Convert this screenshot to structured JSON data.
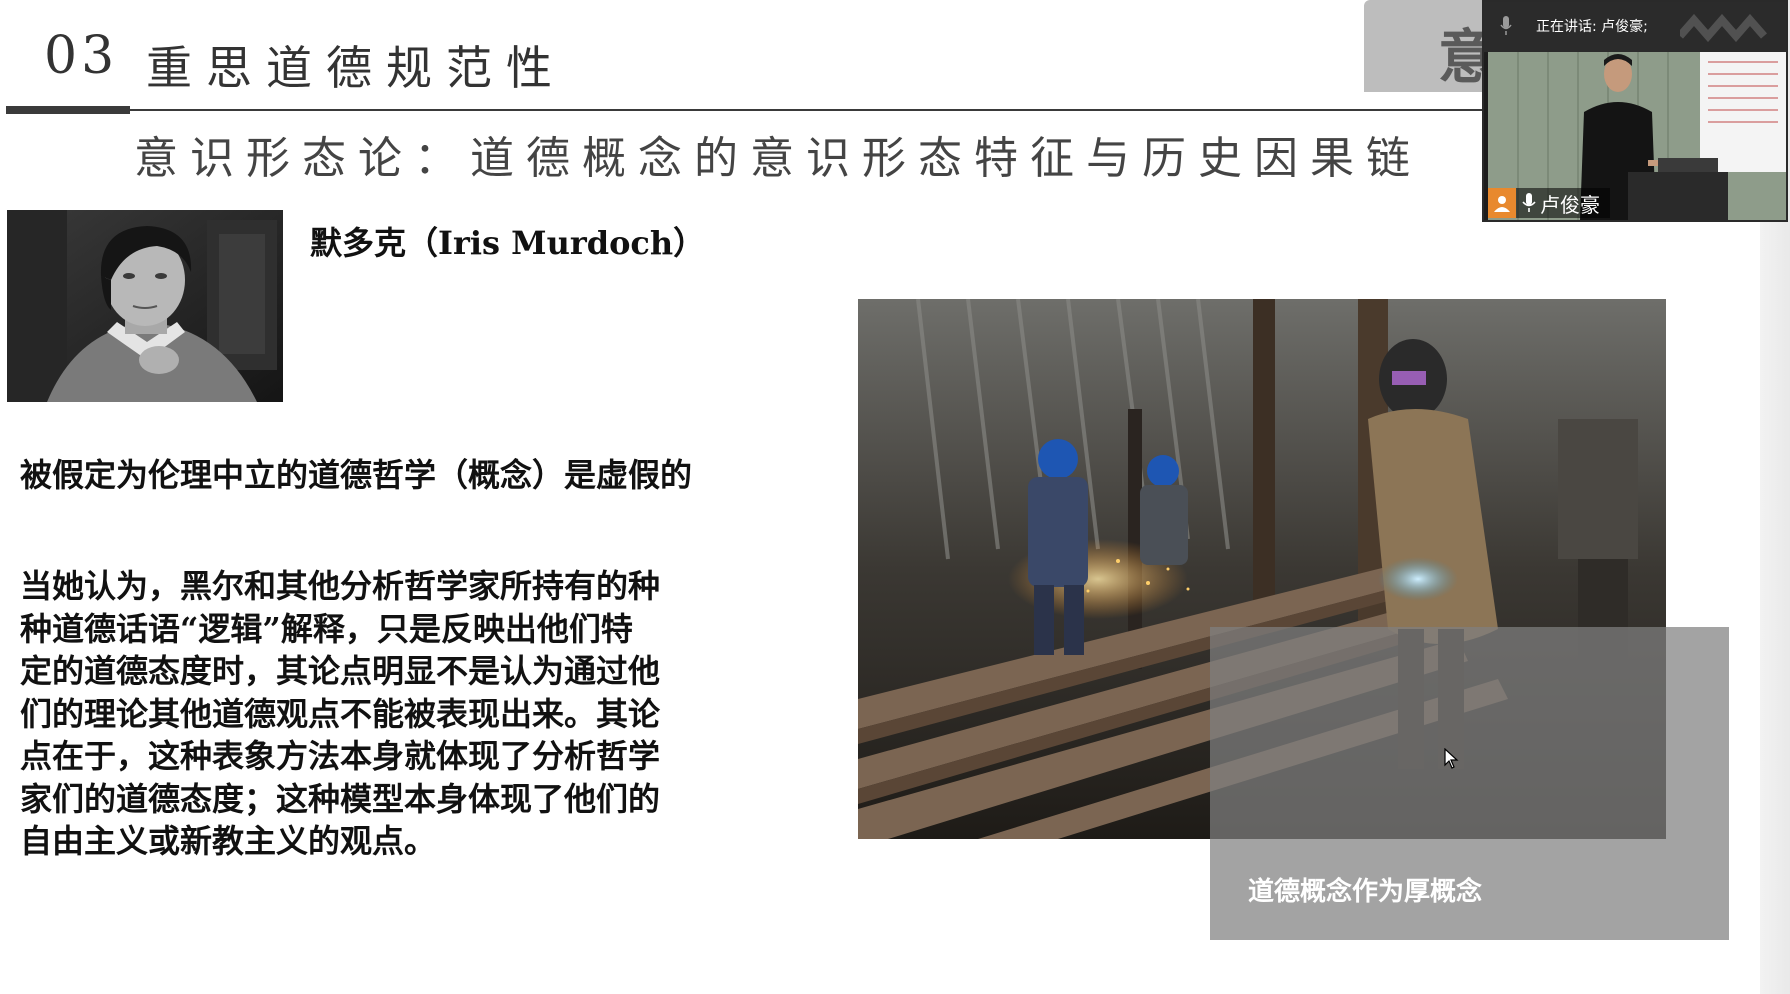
{
  "slide": {
    "section_number": "03",
    "section_title": "重思道德规范性",
    "subtitle": "意识形态论：道德概念的意识形态特征与历史因果链",
    "corner_tab_char": "意",
    "author": "默多克（Iris Murdoch）",
    "thesis": "被假定为伦理中立的道德哲学（概念）是虚假的",
    "paragraph_lines": [
      "当她认为，黑尔和其他分析哲学家所持有的种",
      "种道德话语“逻辑”解释，只是反映出他们特",
      "定的道德态度时，其论点明显不是认为通过他",
      "们的理论其他道德观点不能被表现出来。其论",
      "点在于，这种表象方法本身就体现了分析哲学",
      "家们的道德态度；这种模型本身体现了他们的",
      "自由主义或新教主义的观点。"
    ],
    "caption": "道德概念作为厚概念"
  },
  "video": {
    "speaking_label": "正在讲话: 卢俊豪;",
    "participant_name": "卢俊豪"
  },
  "colors": {
    "rule": "#3a3a3a",
    "caption_bg": "#808080",
    "avatar_accent": "#e8892e"
  }
}
